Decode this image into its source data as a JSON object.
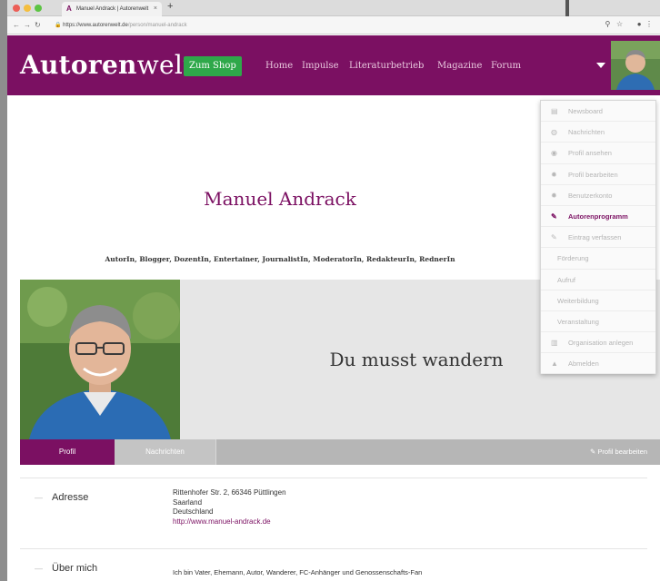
{
  "browser": {
    "tab_title": "Manuel Andrack | Autorenwelt",
    "url_host": "https://www.autorenwelt.de",
    "url_path": "/person/manuel-andrack",
    "new_tab": "+"
  },
  "header": {
    "logo_bold": "Autoren",
    "logo_rest": "welt",
    "shop_label": "Zum Shop",
    "menu": [
      "Home",
      "Impulse",
      "Literaturbetrieb",
      "Magazine",
      "Forum"
    ]
  },
  "profile": {
    "name": "Manuel Andrack",
    "roles": "AutorIn, Blogger, DozentIn, Entertainer, JournalistIn, ModeratorIn, RedakteurIn, RednerIn",
    "motto": "Du musst wandern"
  },
  "tabs": {
    "profil": "Profil",
    "nachrichten": "Nachrichten",
    "edit": "✎ Profil bearbeiten"
  },
  "sections": {
    "address_label": "Adresse",
    "address_lines": [
      "Rittenhofer Str. 2,  66346 Püttlingen",
      "Saarland",
      "Deutschland"
    ],
    "address_link": "http://www.manuel-andrack.de",
    "about_label": "Über mich",
    "about_text": "Ich bin Vater, Ehemann, Autor, Wanderer, FC-Anhänger und Genossenschafts-Fan"
  },
  "dropdown": [
    {
      "label": "Newsboard",
      "icon": "newsboard-icon"
    },
    {
      "label": "Nachrichten",
      "icon": "chat-icon"
    },
    {
      "label": "Profil ansehen",
      "icon": "eye-icon"
    },
    {
      "label": "Profil bearbeiten",
      "icon": "gear-icon"
    },
    {
      "label": "Benutzerkonto",
      "icon": "gear-icon"
    },
    {
      "label": "Autorenprogramm",
      "icon": "pencil-icon",
      "active": true
    },
    {
      "label": "Eintrag verfassen",
      "icon": "pencil-icon"
    },
    {
      "label": "Förderung",
      "sub": true
    },
    {
      "label": "Aufruf",
      "sub": true
    },
    {
      "label": "Weiterbildung",
      "sub": true
    },
    {
      "label": "Veranstaltung",
      "sub": true
    },
    {
      "label": "Organisation anlegen",
      "icon": "building-icon"
    },
    {
      "label": "Abmelden",
      "icon": "lock-icon"
    }
  ],
  "colors": {
    "brand": "#7b1062",
    "shop_green": "#2fa84a"
  }
}
